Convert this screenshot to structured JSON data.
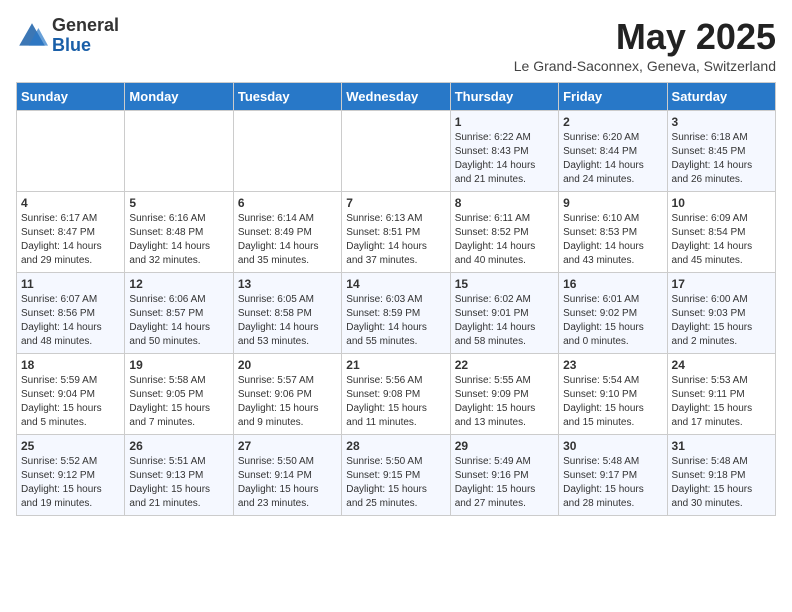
{
  "logo": {
    "general": "General",
    "blue": "Blue"
  },
  "title": "May 2025",
  "subtitle": "Le Grand-Saconnex, Geneva, Switzerland",
  "days_of_week": [
    "Sunday",
    "Monday",
    "Tuesday",
    "Wednesday",
    "Thursday",
    "Friday",
    "Saturday"
  ],
  "weeks": [
    [
      {
        "day": "",
        "sunrise": "",
        "sunset": "",
        "daylight": ""
      },
      {
        "day": "",
        "sunrise": "",
        "sunset": "",
        "daylight": ""
      },
      {
        "day": "",
        "sunrise": "",
        "sunset": "",
        "daylight": ""
      },
      {
        "day": "",
        "sunrise": "",
        "sunset": "",
        "daylight": ""
      },
      {
        "day": "1",
        "sunrise": "6:22 AM",
        "sunset": "8:43 PM",
        "daylight": "14 hours and 21 minutes."
      },
      {
        "day": "2",
        "sunrise": "6:20 AM",
        "sunset": "8:44 PM",
        "daylight": "14 hours and 24 minutes."
      },
      {
        "day": "3",
        "sunrise": "6:18 AM",
        "sunset": "8:45 PM",
        "daylight": "14 hours and 26 minutes."
      }
    ],
    [
      {
        "day": "4",
        "sunrise": "6:17 AM",
        "sunset": "8:47 PM",
        "daylight": "14 hours and 29 minutes."
      },
      {
        "day": "5",
        "sunrise": "6:16 AM",
        "sunset": "8:48 PM",
        "daylight": "14 hours and 32 minutes."
      },
      {
        "day": "6",
        "sunrise": "6:14 AM",
        "sunset": "8:49 PM",
        "daylight": "14 hours and 35 minutes."
      },
      {
        "day": "7",
        "sunrise": "6:13 AM",
        "sunset": "8:51 PM",
        "daylight": "14 hours and 37 minutes."
      },
      {
        "day": "8",
        "sunrise": "6:11 AM",
        "sunset": "8:52 PM",
        "daylight": "14 hours and 40 minutes."
      },
      {
        "day": "9",
        "sunrise": "6:10 AM",
        "sunset": "8:53 PM",
        "daylight": "14 hours and 43 minutes."
      },
      {
        "day": "10",
        "sunrise": "6:09 AM",
        "sunset": "8:54 PM",
        "daylight": "14 hours and 45 minutes."
      }
    ],
    [
      {
        "day": "11",
        "sunrise": "6:07 AM",
        "sunset": "8:56 PM",
        "daylight": "14 hours and 48 minutes."
      },
      {
        "day": "12",
        "sunrise": "6:06 AM",
        "sunset": "8:57 PM",
        "daylight": "14 hours and 50 minutes."
      },
      {
        "day": "13",
        "sunrise": "6:05 AM",
        "sunset": "8:58 PM",
        "daylight": "14 hours and 53 minutes."
      },
      {
        "day": "14",
        "sunrise": "6:03 AM",
        "sunset": "8:59 PM",
        "daylight": "14 hours and 55 minutes."
      },
      {
        "day": "15",
        "sunrise": "6:02 AM",
        "sunset": "9:01 PM",
        "daylight": "14 hours and 58 minutes."
      },
      {
        "day": "16",
        "sunrise": "6:01 AM",
        "sunset": "9:02 PM",
        "daylight": "15 hours and 0 minutes."
      },
      {
        "day": "17",
        "sunrise": "6:00 AM",
        "sunset": "9:03 PM",
        "daylight": "15 hours and 2 minutes."
      }
    ],
    [
      {
        "day": "18",
        "sunrise": "5:59 AM",
        "sunset": "9:04 PM",
        "daylight": "15 hours and 5 minutes."
      },
      {
        "day": "19",
        "sunrise": "5:58 AM",
        "sunset": "9:05 PM",
        "daylight": "15 hours and 7 minutes."
      },
      {
        "day": "20",
        "sunrise": "5:57 AM",
        "sunset": "9:06 PM",
        "daylight": "15 hours and 9 minutes."
      },
      {
        "day": "21",
        "sunrise": "5:56 AM",
        "sunset": "9:08 PM",
        "daylight": "15 hours and 11 minutes."
      },
      {
        "day": "22",
        "sunrise": "5:55 AM",
        "sunset": "9:09 PM",
        "daylight": "15 hours and 13 minutes."
      },
      {
        "day": "23",
        "sunrise": "5:54 AM",
        "sunset": "9:10 PM",
        "daylight": "15 hours and 15 minutes."
      },
      {
        "day": "24",
        "sunrise": "5:53 AM",
        "sunset": "9:11 PM",
        "daylight": "15 hours and 17 minutes."
      }
    ],
    [
      {
        "day": "25",
        "sunrise": "5:52 AM",
        "sunset": "9:12 PM",
        "daylight": "15 hours and 19 minutes."
      },
      {
        "day": "26",
        "sunrise": "5:51 AM",
        "sunset": "9:13 PM",
        "daylight": "15 hours and 21 minutes."
      },
      {
        "day": "27",
        "sunrise": "5:50 AM",
        "sunset": "9:14 PM",
        "daylight": "15 hours and 23 minutes."
      },
      {
        "day": "28",
        "sunrise": "5:50 AM",
        "sunset": "9:15 PM",
        "daylight": "15 hours and 25 minutes."
      },
      {
        "day": "29",
        "sunrise": "5:49 AM",
        "sunset": "9:16 PM",
        "daylight": "15 hours and 27 minutes."
      },
      {
        "day": "30",
        "sunrise": "5:48 AM",
        "sunset": "9:17 PM",
        "daylight": "15 hours and 28 minutes."
      },
      {
        "day": "31",
        "sunrise": "5:48 AM",
        "sunset": "9:18 PM",
        "daylight": "15 hours and 30 minutes."
      }
    ]
  ]
}
